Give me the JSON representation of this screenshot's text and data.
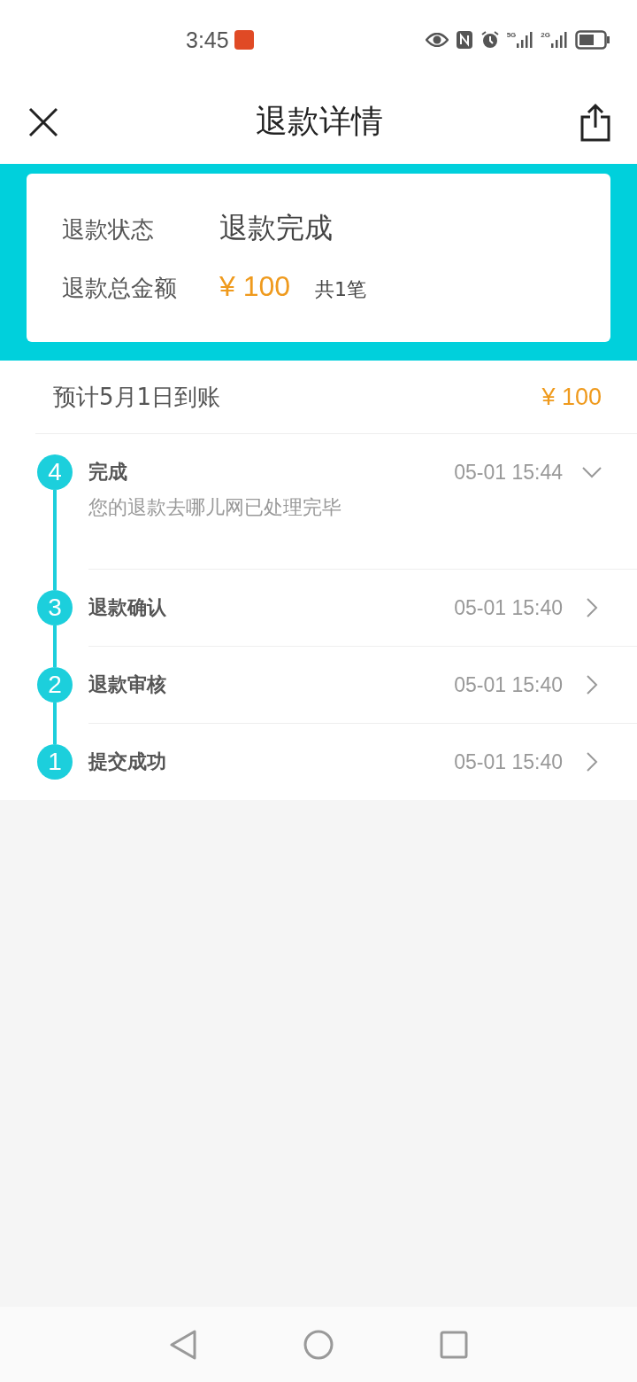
{
  "status_bar": {
    "time": "3:45",
    "network_1": "5G",
    "network_2": "2G"
  },
  "header": {
    "title": "退款详情"
  },
  "summary": {
    "status_label": "退款状态",
    "status_value": "退款完成",
    "amount_label": "退款总金额",
    "amount": "¥ 100",
    "count": "共1笔"
  },
  "arrival": {
    "text": "预计5月1日到账",
    "amount": "¥ 100"
  },
  "steps": [
    {
      "number": "4",
      "title": "完成",
      "time": "05-01 15:44",
      "expanded": true,
      "description": "您的退款去哪儿网已处理完毕"
    },
    {
      "number": "3",
      "title": "退款确认",
      "time": "05-01 15:40",
      "expanded": false
    },
    {
      "number": "2",
      "title": "退款审核",
      "time": "05-01 15:40",
      "expanded": false
    },
    {
      "number": "1",
      "title": "提交成功",
      "time": "05-01 15:40",
      "expanded": false
    }
  ]
}
